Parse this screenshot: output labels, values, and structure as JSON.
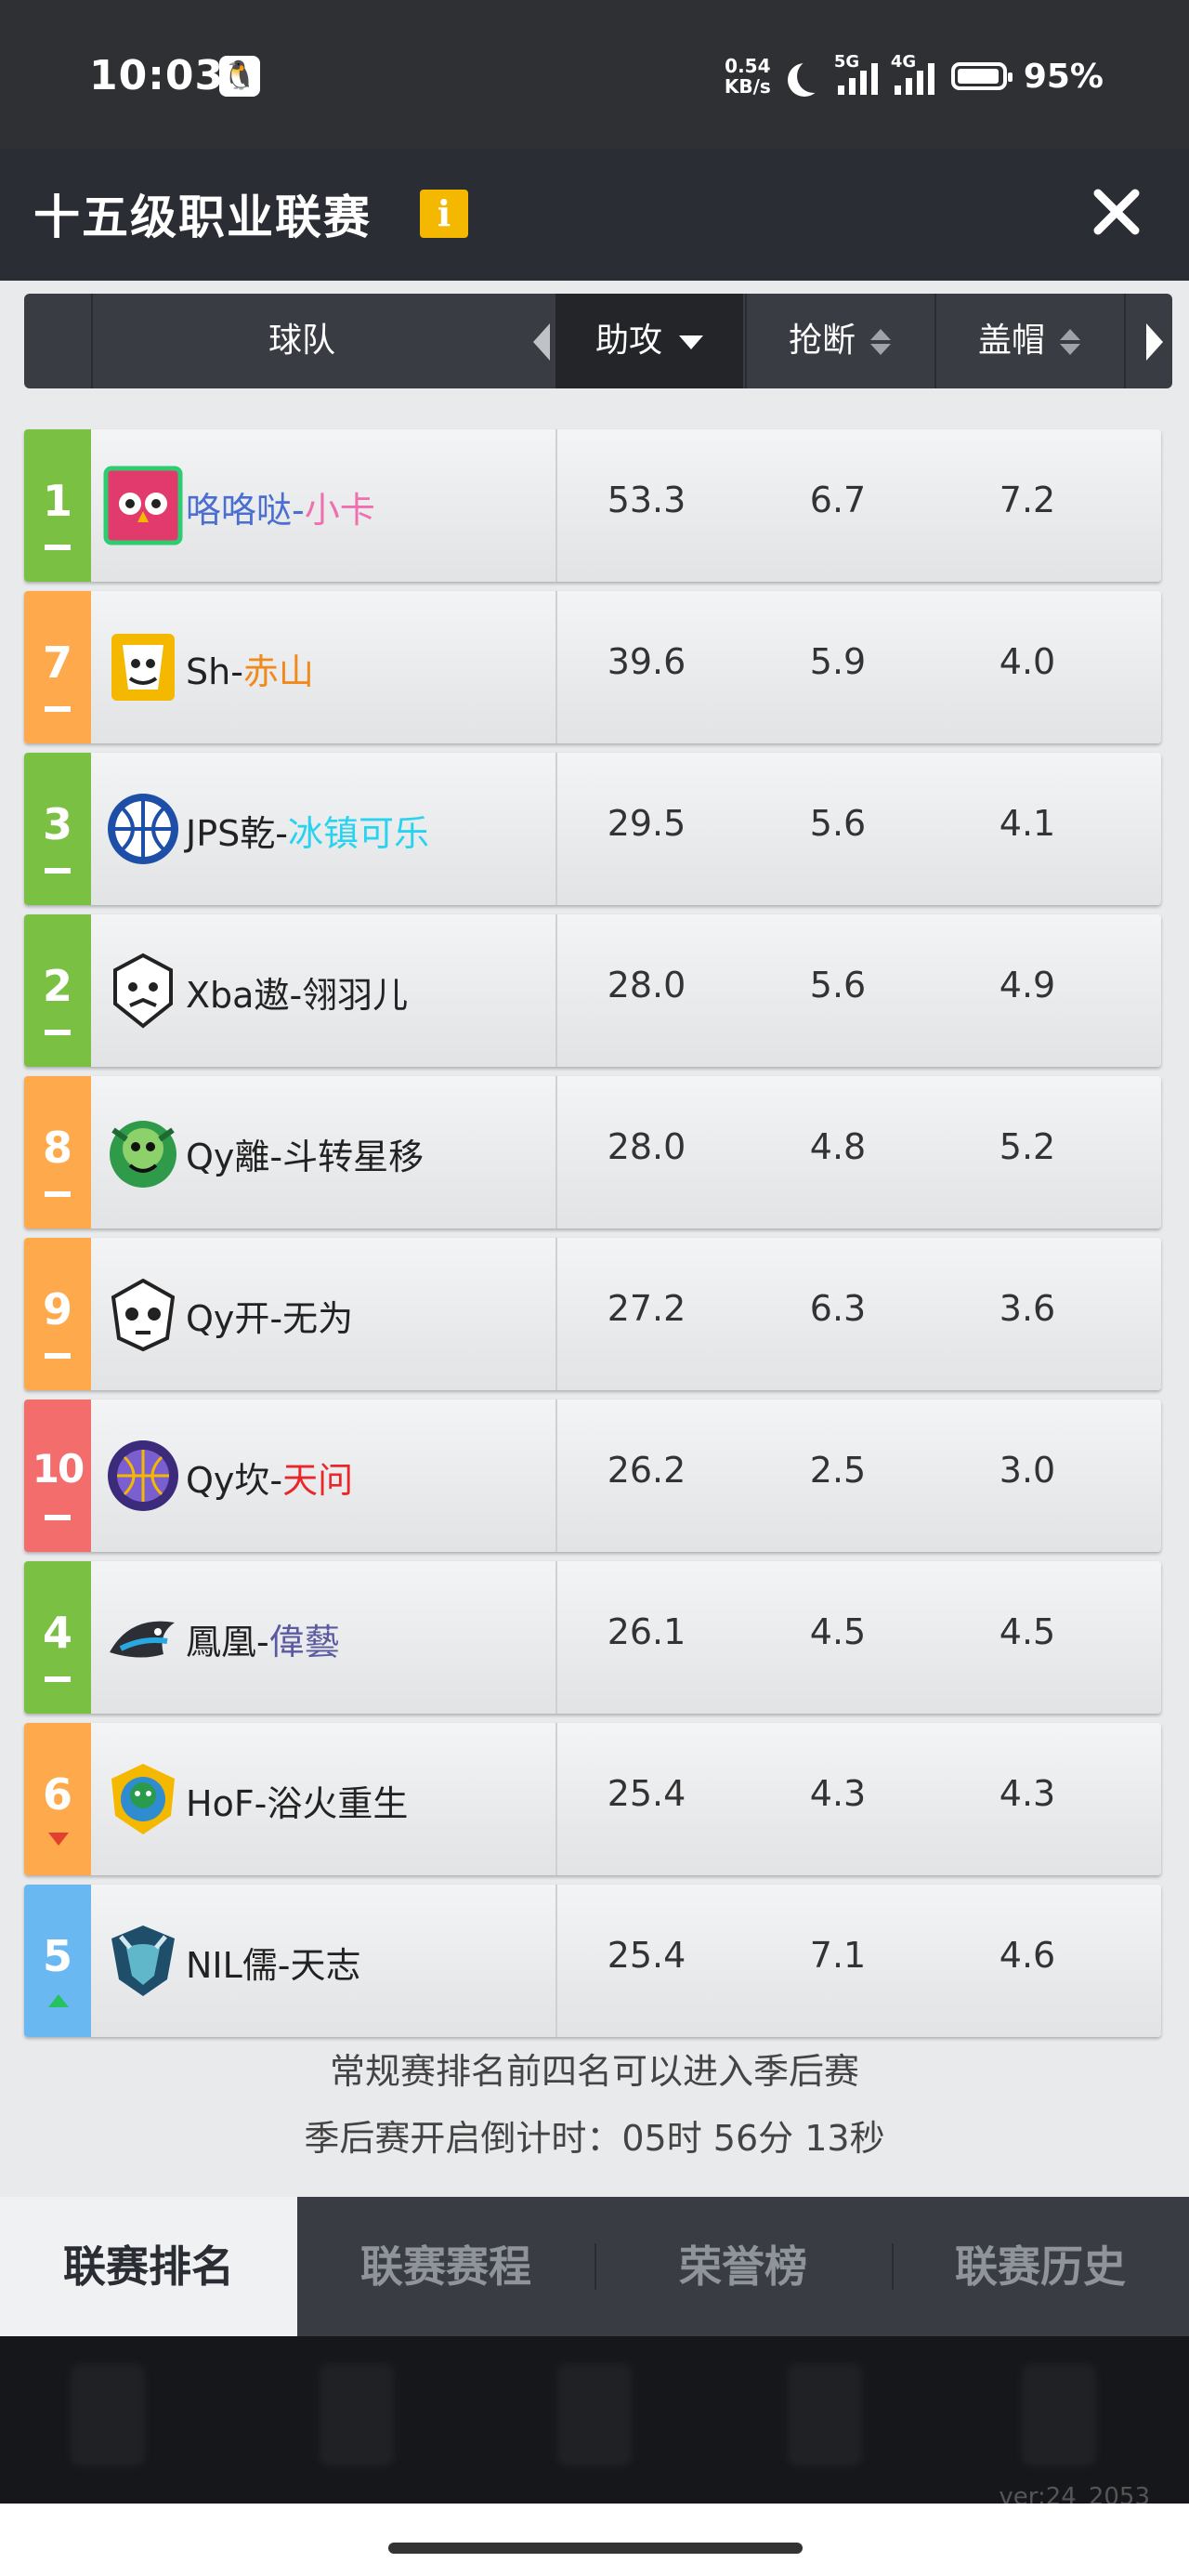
{
  "status_bar": {
    "time": "10:03",
    "net_speed_value": "0.54",
    "net_speed_unit": "KB/s",
    "sim1": "5G",
    "sim2": "4G",
    "battery": "95%"
  },
  "header": {
    "title": "十五级职业联赛",
    "info_icon": "i"
  },
  "table": {
    "columns": {
      "team": "球队",
      "assists": "助攻",
      "steals": "抢断",
      "blocks": "盖帽"
    },
    "sort_column": "助攻",
    "rows": [
      {
        "rank": "1",
        "rank_color": "#7ac143",
        "trend": "same",
        "name_prefix": "咯咯哒-",
        "name_prefix_color": "#4a6fd1",
        "name_suffix": "小卡",
        "name_suffix_color": "#f06fb0",
        "assists": "53.3",
        "steals": "6.7",
        "blocks": "7.2",
        "logo": "owl-logo"
      },
      {
        "rank": "7",
        "rank_color": "#ffa94d",
        "trend": "same",
        "name_prefix": "Sh-",
        "name_prefix_color": "#222222",
        "name_suffix": "赤山",
        "name_suffix_color": "#f08a1c",
        "assists": "39.6",
        "steals": "5.9",
        "blocks": "4.0",
        "logo": "tiger-logo"
      },
      {
        "rank": "3",
        "rank_color": "#7ac143",
        "trend": "same",
        "name_prefix": "JPS乾-",
        "name_prefix_color": "#222222",
        "name_suffix": "冰镇可乐",
        "name_suffix_color": "#29d3f0",
        "assists": "29.5",
        "steals": "5.6",
        "blocks": "4.1",
        "logo": "blue-ball-logo"
      },
      {
        "rank": "2",
        "rank_color": "#7ac143",
        "trend": "same",
        "name_prefix": "Xba遨-翎羽儿",
        "name_prefix_color": "#222222",
        "name_suffix": "",
        "name_suffix_color": "#222222",
        "assists": "28.0",
        "steals": "5.6",
        "blocks": "4.9",
        "logo": "beast-logo"
      },
      {
        "rank": "8",
        "rank_color": "#ffa94d",
        "trend": "same",
        "name_prefix": "Qy離-斗转星移",
        "name_prefix_color": "#222222",
        "name_suffix": "",
        "name_suffix_color": "#222222",
        "assists": "28.0",
        "steals": "4.8",
        "blocks": "5.2",
        "logo": "green-monster-logo"
      },
      {
        "rank": "9",
        "rank_color": "#ffa94d",
        "trend": "same",
        "name_prefix": "Qy开-无为",
        "name_prefix_color": "#222222",
        "name_suffix": "",
        "name_suffix_color": "#222222",
        "assists": "27.2",
        "steals": "6.3",
        "blocks": "3.6",
        "logo": "skull-logo"
      },
      {
        "rank": "10",
        "rank_color": "#f36d6d",
        "trend": "same",
        "name_prefix": "Qy坎-",
        "name_prefix_color": "#222222",
        "name_suffix": "天问",
        "name_suffix_color": "#e8262b",
        "assists": "26.2",
        "steals": "2.5",
        "blocks": "3.0",
        "logo": "purple-ball-logo"
      },
      {
        "rank": "4",
        "rank_color": "#7ac143",
        "trend": "same",
        "name_prefix": "鳳凰-",
        "name_prefix_color": "#222222",
        "name_suffix": "偉藝",
        "name_suffix_color": "#5a5aa0",
        "assists": "26.1",
        "steals": "4.5",
        "blocks": "4.5",
        "logo": "shark-logo"
      },
      {
        "rank": "6",
        "rank_color": "#ffa94d",
        "trend": "down",
        "name_prefix": "HoF-浴火重生",
        "name_prefix_color": "#222222",
        "name_suffix": "",
        "name_suffix_color": "#222222",
        "assists": "25.4",
        "steals": "4.3",
        "blocks": "4.3",
        "logo": "gorilla-logo"
      },
      {
        "rank": "5",
        "rank_color": "#6ab8f2",
        "trend": "up",
        "name_prefix": "NIL儒-天志",
        "name_prefix_color": "#222222",
        "name_suffix": "",
        "name_suffix_color": "#222222",
        "assists": "25.4",
        "steals": "7.1",
        "blocks": "4.6",
        "logo": "bull-logo"
      }
    ]
  },
  "footer_note": {
    "line1": "常规赛排名前四名可以进入季后赛",
    "line2": "季后赛开启倒计时：05时 56分 13秒"
  },
  "tabs": [
    "联赛排名",
    "联赛赛程",
    "荣誉榜",
    "联赛历史"
  ],
  "active_tab": "联赛排名",
  "version": "ver:24_2053"
}
